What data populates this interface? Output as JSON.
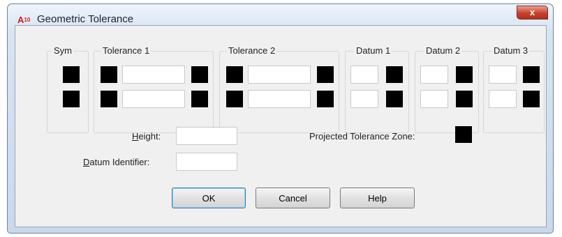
{
  "window": {
    "app_icon": "A",
    "app_icon_sub": "10",
    "title": "Geometric Tolerance",
    "close_label": "x"
  },
  "sections": {
    "sym": "Sym",
    "tolerance1": "Tolerance 1",
    "tolerance2": "Tolerance 2",
    "datum1": "Datum 1",
    "datum2": "Datum 2",
    "datum3": "Datum 3"
  },
  "fields": {
    "height_label_underlined": "H",
    "height_label_rest": "eight:",
    "height_value": "",
    "datum_identifier_label_underlined": "D",
    "datum_identifier_label_rest": "atum Identifier:",
    "datum_identifier_value": "",
    "projected_tolerance_zone_label": "Projected Tolerance Zone:"
  },
  "buttons": {
    "ok": "OK",
    "cancel": "Cancel",
    "help": "Help"
  },
  "icons": {
    "app": "autocad-logo-icon",
    "close": "close-icon"
  }
}
